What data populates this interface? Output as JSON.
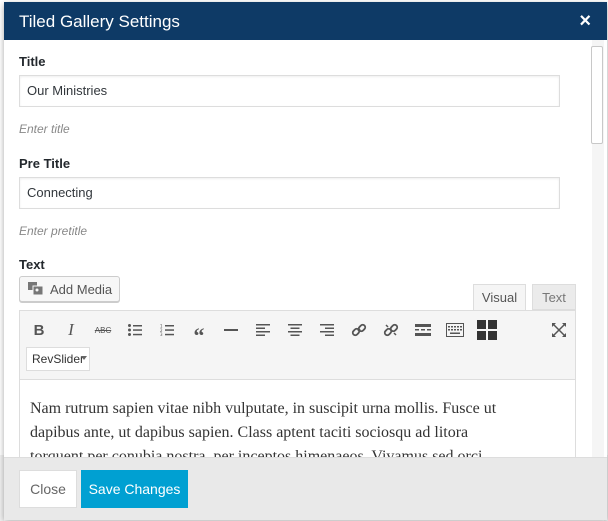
{
  "modal": {
    "title": "Tiled Gallery Settings",
    "close_glyph": "×"
  },
  "fields": {
    "title": {
      "label": "Title",
      "value": "Our Ministries",
      "hint": "Enter title"
    },
    "pretitle": {
      "label": "Pre Title",
      "value": "Connecting",
      "hint": "Enter pretitle"
    },
    "text": {
      "label": "Text"
    }
  },
  "editor": {
    "add_media_label": "Add Media",
    "tabs": {
      "visual": "Visual",
      "text": "Text"
    },
    "toolbar_icons": [
      "bold-icon",
      "italic-icon",
      "strikethrough-icon",
      "bullet-list-icon",
      "numbered-list-icon",
      "blockquote-icon",
      "horizontal-rule-icon",
      "align-left-icon",
      "align-center-icon",
      "align-right-icon",
      "link-icon",
      "unlink-icon",
      "read-more-icon",
      "toolbar-toggle-icon",
      "grid-icon",
      "fullscreen-icon"
    ],
    "revslider_label": "RevSlider",
    "content_lines": [
      "Nam rutrum sapien vitae nibh vulputate, in suscipit urna mollis. Fusce ut",
      "dapibus ante, ut dapibus sapien. Class aptent taciti sociosqu ad litora",
      "torquent per conubia nostra, per inceptos himenaeos. Vivamus sed orci"
    ]
  },
  "footer": {
    "close_label": "Close",
    "save_label": "Save Changes"
  },
  "colors": {
    "header": "#0e3a66",
    "primary": "#00a0d2"
  }
}
